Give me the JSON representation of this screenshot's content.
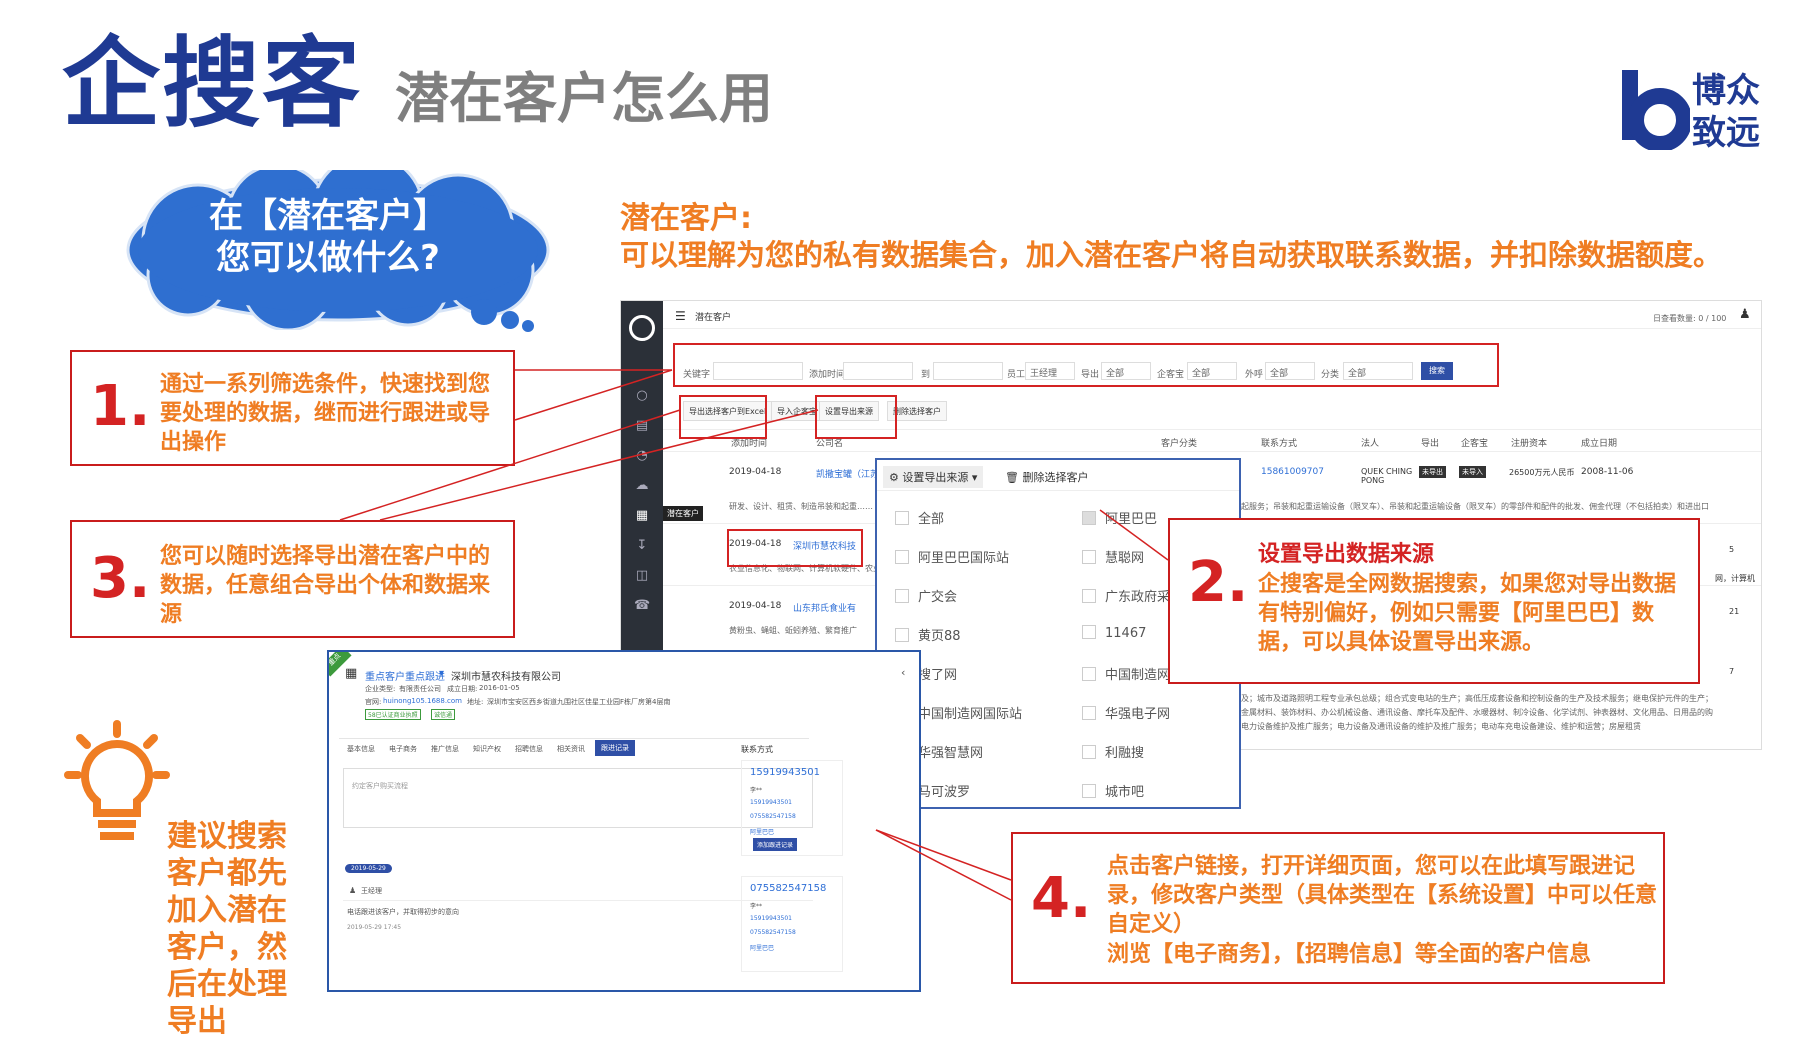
{
  "header": {
    "title": "企搜客",
    "subtitle": "潜在客户怎么用",
    "brand_line1": "博众",
    "brand_line2": "致远"
  },
  "cloud": {
    "line1": "在【潜在客户】",
    "line2": "您可以做什么?"
  },
  "headline": {
    "title": "潜在客户:",
    "body": "可以理解为您的私有数据集合，加入潜在客户将自动获取联系数据，并扣除数据额度。"
  },
  "callouts": [
    {
      "num": "1.",
      "text": "通过一系列筛选条件，快速找到您要处理的数据，继而进行跟进或导出操作"
    },
    {
      "num": "3.",
      "text": "您可以随时选择导出潜在客户中的数据，任意组合导出个体和数据来源"
    },
    {
      "num": "2.",
      "title": "设置导出数据来源",
      "text": "企搜客是全网数据搜索，如果您对导出数据有特别偏好，例如只需要【阿里巴巴】数据，可以具体设置导出来源。"
    },
    {
      "num": "4.",
      "text": "点击客户链接，打开详细页面，您可以在此填写跟进记录，修改客户类型（具体类型在【系统设置】中可以任意自定义）",
      "text2": "浏览【电子商务】，【招聘信息】等全面的客户信息"
    }
  ],
  "tip": {
    "text": "建议搜索客户都先加入潜在客户，然后在处理导出"
  },
  "app": {
    "page_title": "潜在客户",
    "quota": "日查看数量: 0 / 100",
    "sidebar_tooltip": "潜在客户",
    "filters": {
      "keyword_label": "关键字",
      "added_label": "添加时间",
      "to_label": "到",
      "staff_label": "员工",
      "staff_value": "王经理",
      "export_label": "导出",
      "export_value": "全部",
      "qixin_label": "企客宝",
      "qixin_value": "全部",
      "outcall_label": "外呼",
      "outcall_value": "全部",
      "category_label": "分类",
      "category_value": "全部",
      "search_btn": "搜索"
    },
    "toolbar": {
      "export_excel": "导出选择客户到Excel",
      "import": "导入企客宝",
      "set_source": "设置导出来源",
      "delete": "删除选择客户"
    },
    "columns": [
      "添加时间",
      "公司名",
      "客户分类",
      "联系方式",
      "法人",
      "导出",
      "企客宝",
      "注册资本",
      "成立日期"
    ],
    "rows": [
      {
        "date": "2019-04-18",
        "company": "凯撒宝罐（江苏",
        "phone": "15861009707",
        "legal": "QUEK CHING PONG",
        "export": "未导出",
        "qkb": "未导入",
        "capital": "26500万元人民币",
        "founded": "2008-11-06",
        "desc": "研发、设计、租赁、制造吊装和起重……"
      },
      {
        "date": "2019-04-18",
        "company": "深圳市慧农科技",
        "desc": "农业信息化、物联网、计算机软硬件、农业自动化设备和系统的生"
      },
      {
        "date": "2019-04-18",
        "company": "山东邦氏食业有",
        "desc": "黄粉虫、蝇蛆、蚯蚓养殖、繁育推广"
      }
    ],
    "scope_text": "起服务；吊装和起重运输设备（限叉车）、吊装和起重运输设备（限叉车）的零部件和配件的批发、佣金代理（不包括拍卖）和进出口",
    "scope_text2": "及；城市及道路照明工程专业承包总级；组合式变电站的生产；高低压成套设备和控制设备的生产及技术服务；继电保护元件的生产；",
    "scope_text3": "金属材料、装饰材料、办公机械设备、通讯设备、摩托车及配件、水暖器材、制冷设备、化学试剂、钟表器材、文化用品、日用品的购",
    "scope_text4": "电力设备维护及推广服务；电力设备及通讯设备的维护及推广服务；电动车充电设备建设、维护和运营；房屋租赁",
    "right_frag": {
      "r1": "5",
      "r2": "网，计算机",
      "r3": "21",
      "r4": "7"
    }
  },
  "dropdown": {
    "btn_set": "设置导出来源",
    "btn_delete": "删除选择客户",
    "left": [
      "全部",
      "阿里巴巴国际站",
      "广交会",
      "黄页88",
      "搜了网",
      "中国制造网国际站",
      "华强智慧网",
      "马可波罗"
    ],
    "right": [
      "阿里巴巴",
      "慧聪网",
      "广东政府采购",
      "11467",
      "中国制造网",
      "华强电子网",
      "利融搜",
      "城市吧"
    ]
  },
  "detail": {
    "badge": "重点",
    "path": "重点客户重点跟进",
    "company": "深圳市慧农科技有限公司",
    "type_label": "企业类型:",
    "type_value": "有限责任公司",
    "date_label": "成立日期:",
    "date_value": "2016-01-05",
    "site_label": "官网:",
    "site_value": "huinong105.1688.com",
    "addr_label": "地址:",
    "addr_value": "深圳市宝安区西乡街道九围社区佳星工业园F栋厂房第4层南",
    "tags": [
      "58已认证商业执照",
      "诚信通"
    ],
    "tabs": [
      "基本信息",
      "电子商务",
      "推广信息",
      "知识产权",
      "招聘信息",
      "相关资讯",
      "跟进记录"
    ],
    "textarea_placeholder": "约定客户购买流程",
    "add_btn": "添加跟进记录",
    "timeline_date": "2019-05-29",
    "user": "王经理",
    "note": "电话跟进该客户，并取得初步的意向",
    "note_time": "2019-05-29 17:45",
    "contact_title": "联系方式",
    "card1": {
      "head": "15919943501",
      "name": "李**",
      "phone1": "15919943501",
      "phone2": "075582547158",
      "src": "阿里巴巴"
    },
    "card2": {
      "head": "075582547158",
      "name": "李**",
      "phone1": "15919943501",
      "phone2": "075582547158",
      "src": "阿里巴巴"
    }
  },
  "colors": {
    "brand_blue": "#1f3a93",
    "accent_orange": "#ef7d23",
    "callout_red": "#d42323",
    "cloud_blue": "#2f6fd0"
  }
}
